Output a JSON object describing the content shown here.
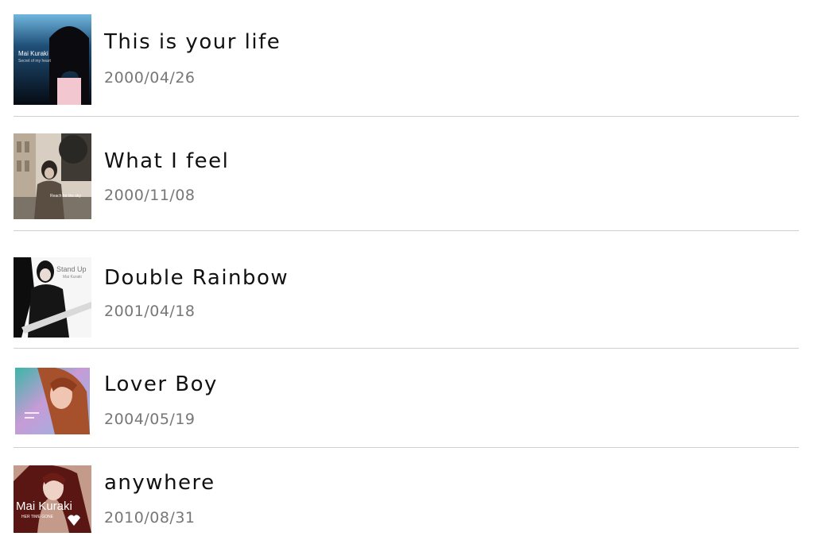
{
  "releases": [
    {
      "title": "This is your life",
      "date": "2000/04/26",
      "cover": {
        "artist": "Mai Kuraki",
        "subtitle": "Secret of my heart"
      }
    },
    {
      "title": "What I feel",
      "date": "2000/11/08",
      "cover": {
        "subtitle": "Reach for the sky"
      }
    },
    {
      "title": "Double Rainbow",
      "date": "2001/04/18",
      "cover": {
        "line1": "Stand Up",
        "line2": "Mai Kuraki"
      }
    },
    {
      "title": "Lover Boy",
      "date": "2004/05/19",
      "cover": {}
    },
    {
      "title": "anywhere",
      "date": "2010/08/31",
      "cover": {
        "artist": "Mai Kuraki",
        "subtitle": "HER TIME GONE"
      }
    }
  ]
}
